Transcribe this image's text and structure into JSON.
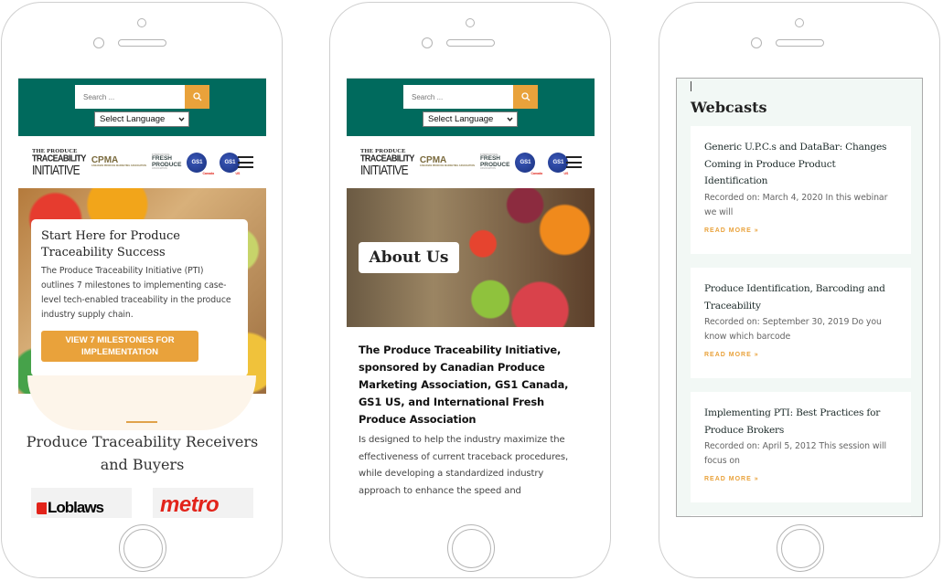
{
  "common": {
    "search_placeholder": "Search ...",
    "language_select": "Select Language",
    "logos": {
      "pti_line1": "THE PRODUCE",
      "pti_line2": "TRACEABILITY",
      "pti_line3": "INITIATIVE",
      "cpma": "CPMA",
      "cpma_sub": "CANADIAN PRODUCE MARKETING ASSOCIATION",
      "fresh_top": "INTERNATIONAL",
      "fresh_line1": "FRESH",
      "fresh_line2": "PRODUCE",
      "fresh_bottom": "ASSOCIATION",
      "gs1": "GS1",
      "gs1_canada": "Canada",
      "gs1_us": "US"
    },
    "colors": {
      "primary_teal": "#006a5d",
      "accent_orange": "#e9a23b"
    }
  },
  "phone1": {
    "hero_title": "Start Here for Produce Traceability Success",
    "hero_text": "The Produce Traceability Initiative (PTI) outlines 7 milestones to implementing case-level tech-enabled traceability in the produce industry supply chain.",
    "hero_button": "VIEW 7 MILESTONES FOR IMPLEMENTATION",
    "section_title": "Produce Traceability Receivers and Buyers",
    "brands": [
      "Loblaws",
      "metro"
    ]
  },
  "phone2": {
    "banner_title": "About Us",
    "heading": "The Produce Traceability Initiative, sponsored by Canadian Produce Marketing Association, GS1 Canada, GS1 US, and International Fresh Produce Association",
    "body": "Is designed to help the industry maximize the effectiveness of current traceback procedures, while developing a standardized industry approach to enhance the speed and"
  },
  "phone3": {
    "title": "Webcasts",
    "read_more": "READ MORE »",
    "webcasts": [
      {
        "title": "Generic U.P.C.s and DataBar: Changes Coming in Produce Product Identification",
        "excerpt": "Recorded on: March 4, 2020 In this webinar we will"
      },
      {
        "title": "Produce Identification, Barcoding and Traceability",
        "excerpt": "Recorded on: September 30, 2019 Do you know which barcode"
      },
      {
        "title": "Implementing PTI: Best Practices for Produce Brokers",
        "excerpt": "Recorded on: April 5, 2012 This session will focus on"
      }
    ]
  }
}
